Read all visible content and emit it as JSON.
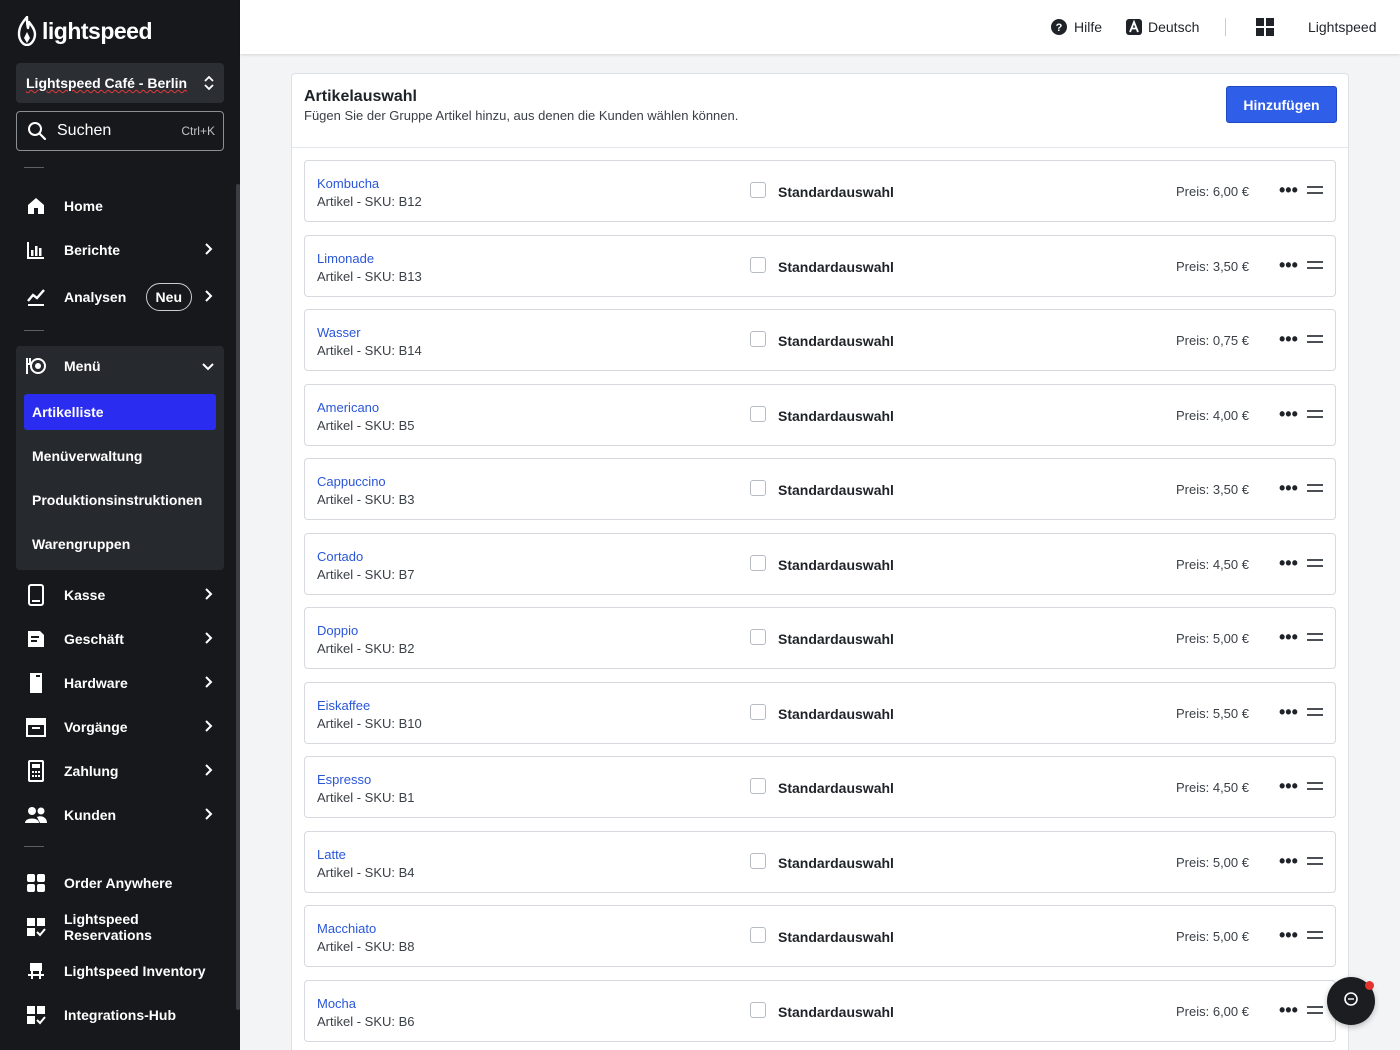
{
  "brand": {
    "name": "lightspeed"
  },
  "location": {
    "name": "Lightspeed Café - Berlin"
  },
  "search": {
    "label": "Suchen",
    "shortcut": "Ctrl+K"
  },
  "nav": {
    "home": "Home",
    "berichte": "Berichte",
    "analysen": "Analysen",
    "analysen_badge": "Neu",
    "menu": "Menü",
    "menu_sub": [
      "Artikelliste",
      "Menüverwaltung",
      "Produktionsinstruktionen",
      "Warengruppen"
    ],
    "kasse": "Kasse",
    "geschaeft": "Geschäft",
    "hardware": "Hardware",
    "vorgaenge": "Vorgänge",
    "zahlung": "Zahlung",
    "kunden": "Kunden",
    "order_anywhere": "Order Anywhere",
    "reservations": "Lightspeed Reservations",
    "inventory": "Lightspeed Inventory",
    "integrations": "Integrations-Hub"
  },
  "topbar": {
    "help": "Hilfe",
    "language": "Deutsch",
    "account": "Lightspeed"
  },
  "section": {
    "title": "Artikelauswahl",
    "subtitle": "Fügen Sie der Gruppe Artikel hinzu, aus denen die Kunden wählen können.",
    "add_button": "Hinzufügen",
    "default_label": "Standardauswahl"
  },
  "items": [
    {
      "name": "Kombucha",
      "sku": "Artikel - SKU: B12",
      "price": "Preis: 6,00 €"
    },
    {
      "name": "Limonade",
      "sku": "Artikel - SKU: B13",
      "price": "Preis: 3,50 €"
    },
    {
      "name": "Wasser",
      "sku": "Artikel - SKU: B14",
      "price": "Preis: 0,75 €"
    },
    {
      "name": "Americano",
      "sku": "Artikel - SKU: B5",
      "price": "Preis: 4,00 €"
    },
    {
      "name": "Cappuccino",
      "sku": "Artikel - SKU: B3",
      "price": "Preis: 3,50 €"
    },
    {
      "name": "Cortado",
      "sku": "Artikel - SKU: B7",
      "price": "Preis: 4,50 €"
    },
    {
      "name": "Doppio",
      "sku": "Artikel - SKU: B2",
      "price": "Preis: 5,00 €"
    },
    {
      "name": "Eiskaffee",
      "sku": "Artikel - SKU: B10",
      "price": "Preis: 5,50 €"
    },
    {
      "name": "Espresso",
      "sku": "Artikel - SKU: B1",
      "price": "Preis: 4,50 €"
    },
    {
      "name": "Latte",
      "sku": "Artikel - SKU: B4",
      "price": "Preis: 5,00 €"
    },
    {
      "name": "Macchiato",
      "sku": "Artikel - SKU: B8",
      "price": "Preis: 5,00 €"
    },
    {
      "name": "Mocha",
      "sku": "Artikel - SKU: B6",
      "price": "Preis: 6,00 €"
    }
  ],
  "colors": {
    "accent": "#2f5ee8",
    "active_nav": "#2a2cf0",
    "link": "#2a56d8",
    "sidebar": "#16181b"
  }
}
